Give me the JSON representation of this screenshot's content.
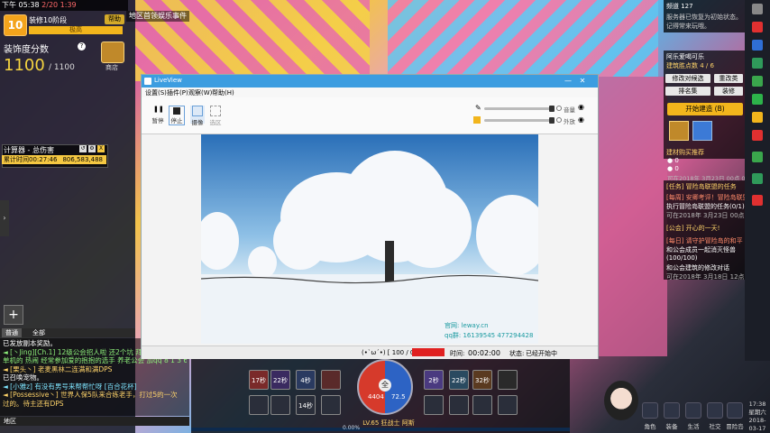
{
  "hud": {
    "time_label": "下午 05:38",
    "currency": "2/20 1:39",
    "area_name": "地区首领娱乐事件",
    "level": "10",
    "level_name": "装修10阶段",
    "help_label": "帮助",
    "status_label": "极高",
    "score_label": "装饰度分数",
    "score_value": "1100",
    "score_max": "/ 1100",
    "chest_label": "商店"
  },
  "calculator": {
    "title": "计算器 - 总伤害",
    "time_label": "累计时间00:27:46",
    "damage": "806,583,488",
    "close_label": "X"
  },
  "social": {
    "icon": "+",
    "label": "社群"
  },
  "chat": {
    "tabs": [
      "普通",
      "全部"
    ],
    "lines": [
      {
        "text": "已发放副本奖励。",
        "cls": "c-white"
      },
      {
        "text": "◄ [丶Jing][Ch.1] 12级公会招人啦 还2个坑 拜托带新人 找一个",
        "cls": "c-green"
      },
      {
        "text": "单机的 热闹 经常参加爱的抱抱的选手 养老公会 加qq 8 1 3 6",
        "cls": "c-green"
      },
      {
        "text": "◄ [栗头丶] 老麦黑林二连满和满DPS",
        "cls": "c-yellow"
      },
      {
        "text": "已召唤宠物。",
        "cls": "c-white"
      },
      {
        "text": "◄ [小雅z] 有没有男号来帮帮忙呀 [百合花杯]",
        "cls": "c-cyan"
      },
      {
        "text": "◄ [Possessive丶] 世界人保5队来合练老手，打过5的一次",
        "cls": "c-yellow"
      },
      {
        "text": "过的。待主还有DPS",
        "cls": "c-yellow"
      }
    ],
    "input_label": "地区"
  },
  "skillbar": {
    "hp_value": "4404",
    "mp_value": "72.5",
    "orb_label": "全",
    "level_label": "LV.65 狂战士 阿斯",
    "exp_text": "0.00%",
    "skills_top": [
      "17秒",
      "22秒",
      "4秒",
      "",
      "2秒",
      "22秒",
      "32秒",
      ""
    ],
    "skills_bottom": [
      "",
      "",
      "14秒",
      "",
      "",
      "",
      "",
      ""
    ]
  },
  "right_panel": {
    "channel": "频道 127",
    "notice_1": "服务器已恢复为初始状态。",
    "notice_2": "记得常来玩哦。",
    "section_title": "阿乐爱喝可乐",
    "build_progress": "建筑胜点数 4 / 6",
    "buttons": [
      "修改对候选",
      "重改类",
      "排名集",
      "装修"
    ],
    "build_button": "开始建造 (B)",
    "recommend": "建材购买推荐",
    "coins_1": "0",
    "coins_2": "0",
    "date_1": "可在2018年 3月23日 00点 00分",
    "task_header": "[任务] 冒险岛联盟的任务",
    "tasks": [
      "[每周] 安卿考评！冒险岛联盟",
      "执行冒险岛联盟的任务(0/1)",
      "可在2018年 3月23日 00点 00分",
      "[公会] 开心的一天!",
      "[每日] 请守护冒险岛的和平",
      "和公会成员一起消灭怪兽",
      "(100/100)",
      "和公会建筑的修改对话",
      "可在2018年 3月18日 12点 14分"
    ]
  },
  "menu": {
    "items": [
      "角色",
      "装备",
      "生活",
      "社交",
      "冒险岛"
    ]
  },
  "clock": {
    "time": "17:38",
    "weekday": "星期六",
    "date": "2018-03-17"
  },
  "liveview": {
    "title": "LiveView",
    "menu": [
      "设置(S)",
      "插件(P)",
      "观察(W)",
      "帮助(H)"
    ],
    "toolbar": [
      "暂停",
      "停止",
      "摄像",
      "选区"
    ],
    "mic_label": "音量",
    "speaker_label": "外放",
    "canvas_watermark_1": "官网: leway.cn",
    "canvas_watermark_2": "qq群: 16139545 477294428",
    "status_left": "(•`ω´•) [ 100 / 0 ]",
    "timer_label": "时间:",
    "timer": "00:02:00",
    "state_label": "状态:",
    "state_value": "已经开始中"
  }
}
